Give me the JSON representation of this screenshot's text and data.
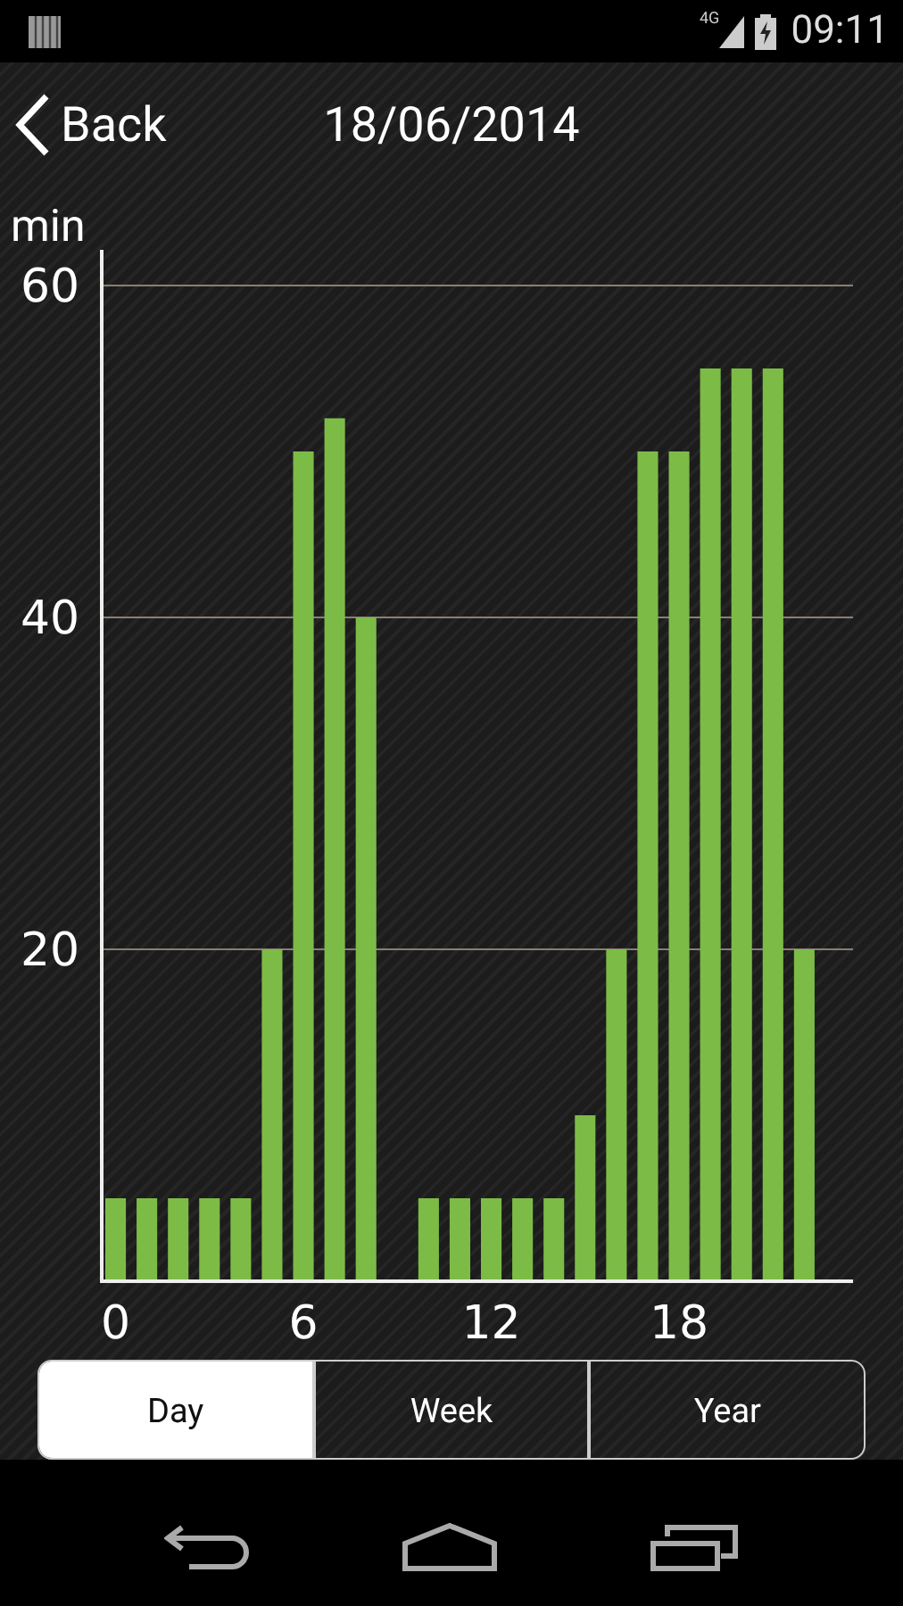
{
  "status_bar": {
    "network": "4G",
    "time": "09:11"
  },
  "header": {
    "back_label": "Back",
    "title": "18/06/2014"
  },
  "chart": {
    "chart_data": {
      "type": "bar",
      "ylabel": "min",
      "x": [
        0,
        1,
        2,
        3,
        4,
        5,
        6,
        7,
        8,
        9,
        10,
        11,
        12,
        13,
        14,
        15,
        16,
        17,
        18,
        19,
        20,
        21,
        22,
        23
      ],
      "series": [
        {
          "color": "#7dbb47",
          "values": [
            5,
            5,
            5,
            5,
            5,
            20,
            50,
            52,
            40,
            0,
            5,
            5,
            5,
            5,
            5,
            10,
            20,
            50,
            50,
            55,
            55,
            55,
            20,
            0
          ]
        }
      ],
      "xlim": [
        -0.5,
        23.5
      ],
      "ylim": [
        0,
        60
      ],
      "yticks": [
        20,
        40,
        60
      ],
      "xticks": [
        0,
        6,
        12,
        18
      ]
    }
  },
  "periods": [
    {
      "label": "Day",
      "selected": true
    },
    {
      "label": "Week",
      "selected": false
    },
    {
      "label": "Year",
      "selected": false
    }
  ]
}
